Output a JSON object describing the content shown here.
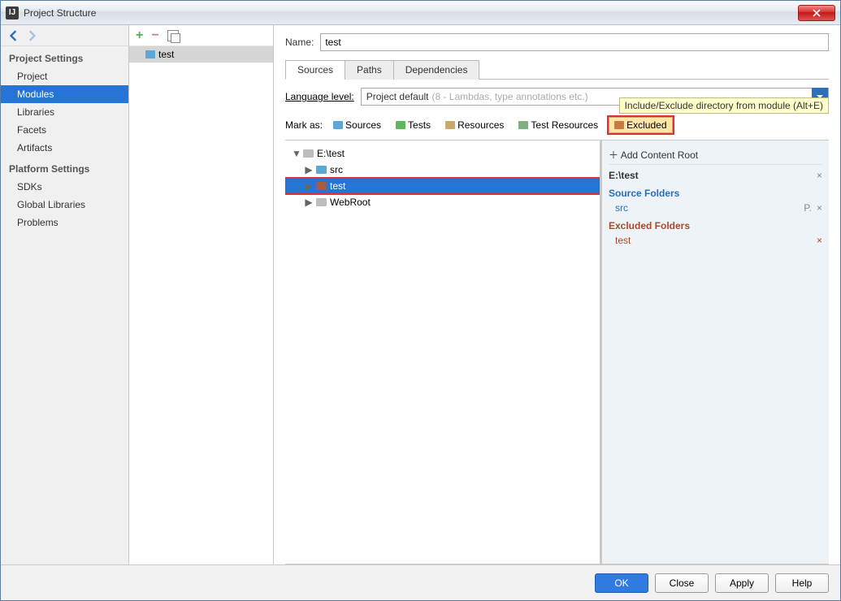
{
  "window": {
    "title": "Project Structure"
  },
  "sidebar": {
    "sections": [
      {
        "title": "Project Settings",
        "items": [
          "Project",
          "Modules",
          "Libraries",
          "Facets",
          "Artifacts"
        ],
        "selected": 1
      },
      {
        "title": "Platform Settings",
        "items": [
          "SDKs",
          "Global Libraries"
        ]
      },
      {
        "title": "",
        "items": [
          "Problems"
        ]
      }
    ]
  },
  "modules": {
    "items": [
      "test"
    ],
    "selected": 0
  },
  "form": {
    "name_label": "Name:",
    "name_value": "test"
  },
  "tabs": {
    "items": [
      "Sources",
      "Paths",
      "Dependencies"
    ],
    "active": 0
  },
  "language": {
    "label": "Language level:",
    "value": "Project default",
    "hint": "(8 - Lambdas, type annotations etc.)"
  },
  "mark": {
    "label": "Mark as:",
    "chips": [
      {
        "label": "Sources",
        "color": "#5aa8d8"
      },
      {
        "label": "Tests",
        "color": "#5cb85c"
      },
      {
        "label": "Resources",
        "color": "#c9a96b"
      },
      {
        "label": "Test Resources",
        "color": "#7fae7f"
      },
      {
        "label": "Excluded",
        "color": "#c97a42",
        "highlight": true
      }
    ],
    "tooltip": "Include/Exclude directory from module (Alt+E)"
  },
  "tree": {
    "root": "E:\\test",
    "children": [
      {
        "label": "src",
        "type": "blue"
      },
      {
        "label": "test",
        "type": "brown",
        "selected": true,
        "highlight": true
      },
      {
        "label": "WebRoot",
        "type": "gray"
      }
    ]
  },
  "right": {
    "add_root": "Add Content Root",
    "root": "E:\\test",
    "source_head": "Source Folders",
    "sources": [
      "src"
    ],
    "excluded_head": "Excluded Folders",
    "excluded": [
      "test"
    ]
  },
  "footer": {
    "ok": "OK",
    "close": "Close",
    "apply": "Apply",
    "help": "Help"
  }
}
